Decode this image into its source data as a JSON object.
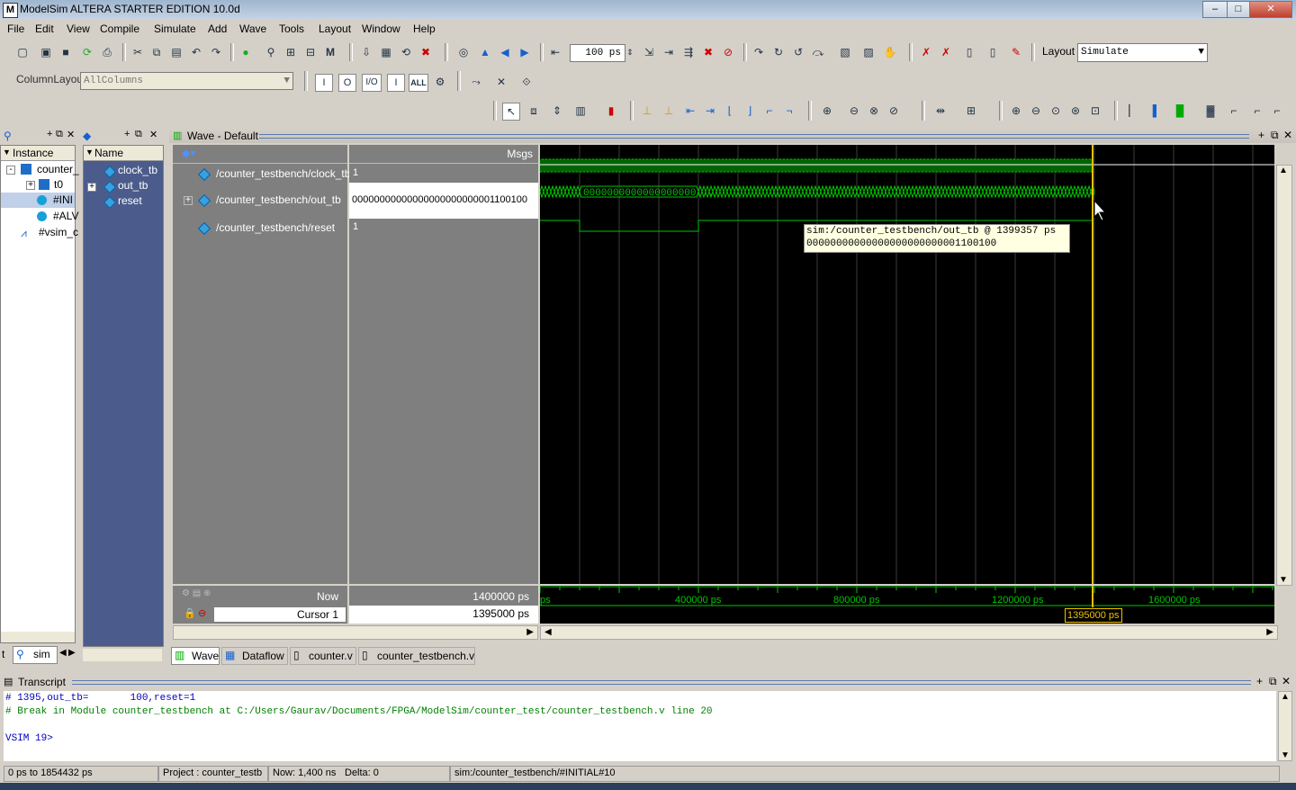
{
  "window": {
    "title": "ModelSim ALTERA STARTER EDITION 10.0d"
  },
  "menu": [
    "File",
    "Edit",
    "View",
    "Compile",
    "Simulate",
    "Add",
    "Wave",
    "Tools",
    "Layout",
    "Window",
    "Help"
  ],
  "toolbar": {
    "zoom_value": "100 ps",
    "layout_label": "Layout",
    "layout_value": "Simulate",
    "column_layout_label": "ColumnLayout",
    "column_layout_value": "AllColumns",
    "filter_buttons": [
      "I",
      "O",
      "I/O",
      "I",
      "ALL"
    ]
  },
  "instance_panel": {
    "header": "Instance",
    "items": [
      "counter_",
      "t0",
      "#INI",
      "#ALV",
      "#vsim_c"
    ],
    "tab": "sim"
  },
  "objects_panel": {
    "header": "Name",
    "items": [
      "clock_tb",
      "out_tb",
      "reset"
    ]
  },
  "wave": {
    "title": "Wave - Default",
    "msgs_header": "Msgs",
    "signals": [
      {
        "name": "/counter_testbench/clock_tb",
        "value": "1"
      },
      {
        "name": "/counter_testbench/out_tb",
        "value": "00000000000000000000000001100100"
      },
      {
        "name": "/counter_testbench/reset",
        "value": "1"
      }
    ],
    "out_segment": "0000000000000000000...",
    "now_label": "Now",
    "now_value": "1400000 ps",
    "cursor_label": "Cursor 1",
    "cursor_value": "1395000 ps",
    "cursor_tag": "1395000 ps",
    "ticks": [
      "ps",
      "400000 ps",
      "800000 ps",
      "1200000 ps",
      "1600000 ps"
    ],
    "tooltip_line1": "sim:/counter_testbench/out_tb @ 1399357 ps",
    "tooltip_line2": "00000000000000000000000001100100"
  },
  "tabs": [
    "Wave",
    "Dataflow",
    "counter.v",
    "counter_testbench.v"
  ],
  "transcript": {
    "title": "Transcript",
    "lines": [
      "# 1395,out_tb=       100,reset=1",
      "# Break in Module counter_testbench at C:/Users/Gaurav/Documents/FPGA/ModelSim/counter_test/counter_testbench.v line 20"
    ],
    "prompt": "VSIM 19>"
  },
  "status": {
    "range": "0 ps to 1854432 ps",
    "project": "Project : counter_testb",
    "now": "Now: 1,400 ns",
    "delta": "Delta: 0",
    "context": "sim:/counter_testbench/#INITIAL#10"
  },
  "colors": {
    "wave_green": "#00c800",
    "cursor_yellow": "#f0c000",
    "tooltip_bg": "#ffffe1",
    "transcript_blue": "#0000c0",
    "transcript_green": "#008000"
  }
}
